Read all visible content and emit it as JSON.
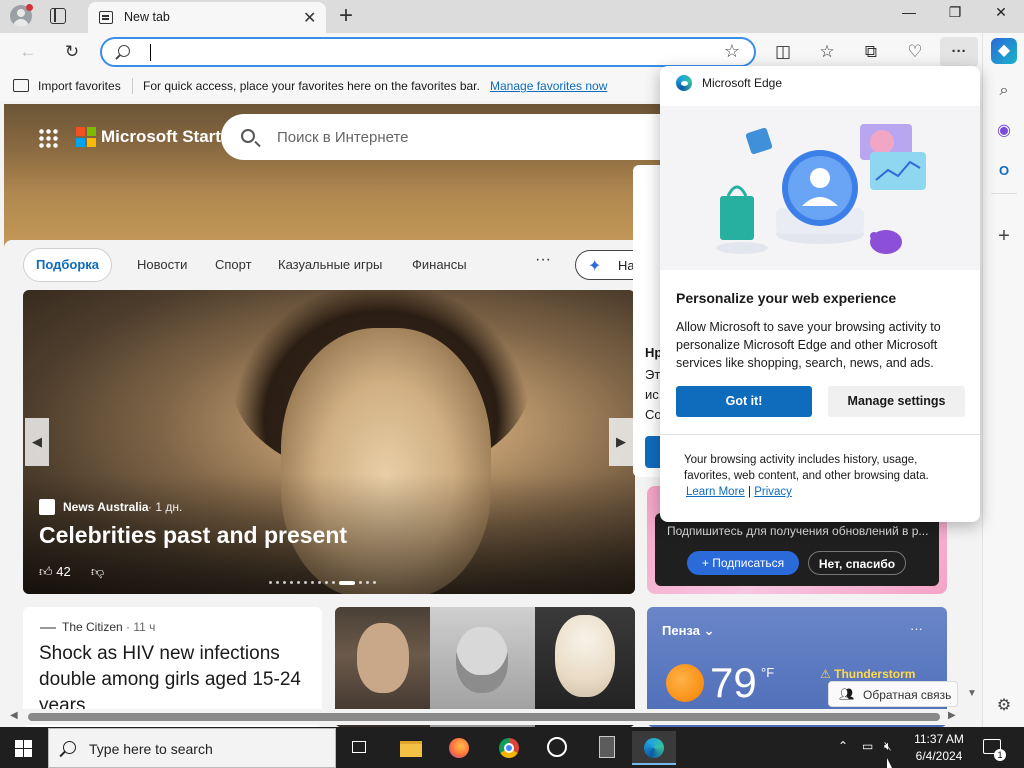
{
  "browser": {
    "tab_title": "New tab",
    "tab_close": "✕",
    "new_tab": "+",
    "window_controls": {
      "minimize": "—",
      "restore": "❐",
      "close": "✕"
    }
  },
  "toolbar": {
    "back": "←",
    "refresh": "↻",
    "address_value": "",
    "star": "☆",
    "split": "◫",
    "favorites": "☆",
    "collections": "⧉",
    "performance": "♡",
    "more": "···"
  },
  "favorites_bar": {
    "import_label": "Import favorites",
    "hint": "For quick access, place your favorites here on the favorites bar.",
    "manage_link": "Manage favorites now"
  },
  "newtab": {
    "brand": "Microsoft Start",
    "search_placeholder": "Поиск в Интернете",
    "nav": {
      "active": "Подборка",
      "items": [
        "Новости",
        "Спорт",
        "Казуальные игры",
        "Финансы"
      ],
      "more": "···",
      "personalize_partial": "На"
    },
    "hero": {
      "source": "News Australia",
      "time": "· 1 дн.",
      "title": "Celebrities past and present",
      "likes": "42",
      "prev": "◀",
      "next": "▶"
    },
    "side_card": {
      "line1": "Нр",
      "line2": "Эт",
      "line3": "ис",
      "line4": "Со"
    },
    "subscribe": {
      "text": "Подпишитесь для получения обновлений в р...",
      "subscribe_btn": "+ Подписаться",
      "decline_btn": "Нет, спасибо"
    },
    "news": {
      "source": "The Citizen",
      "time": "· 11 ч",
      "title": "Shock as HIV new infections double among girls aged 15-24 years"
    },
    "weather": {
      "city": "Пенза",
      "chevron": "⌄",
      "more": "···",
      "temp": "79",
      "unit": "°F",
      "condition": "Thunderstorm"
    },
    "feedback": "Обратная связь"
  },
  "popup": {
    "header": "Microsoft Edge",
    "title": "Personalize your web experience",
    "body": "Allow Microsoft to save your browsing activity to personalize Microsoft Edge and other Microsoft services like shopping, search, news, and ads.",
    "got_it": "Got it!",
    "manage": "Manage settings",
    "note": "Your browsing activity includes history, usage, favorites, web content, and other browsing data.",
    "learn_more": "Learn More",
    "separator": "|",
    "privacy": "Privacy"
  },
  "taskbar": {
    "search_placeholder": "Type here to search",
    "time": "11:37 AM",
    "date": "6/4/2024",
    "notifications": "1"
  },
  "colors": {
    "accent": "#0f6cbd",
    "address_focus": "#3a8ee6",
    "taskbar": "#1f1f1f"
  }
}
